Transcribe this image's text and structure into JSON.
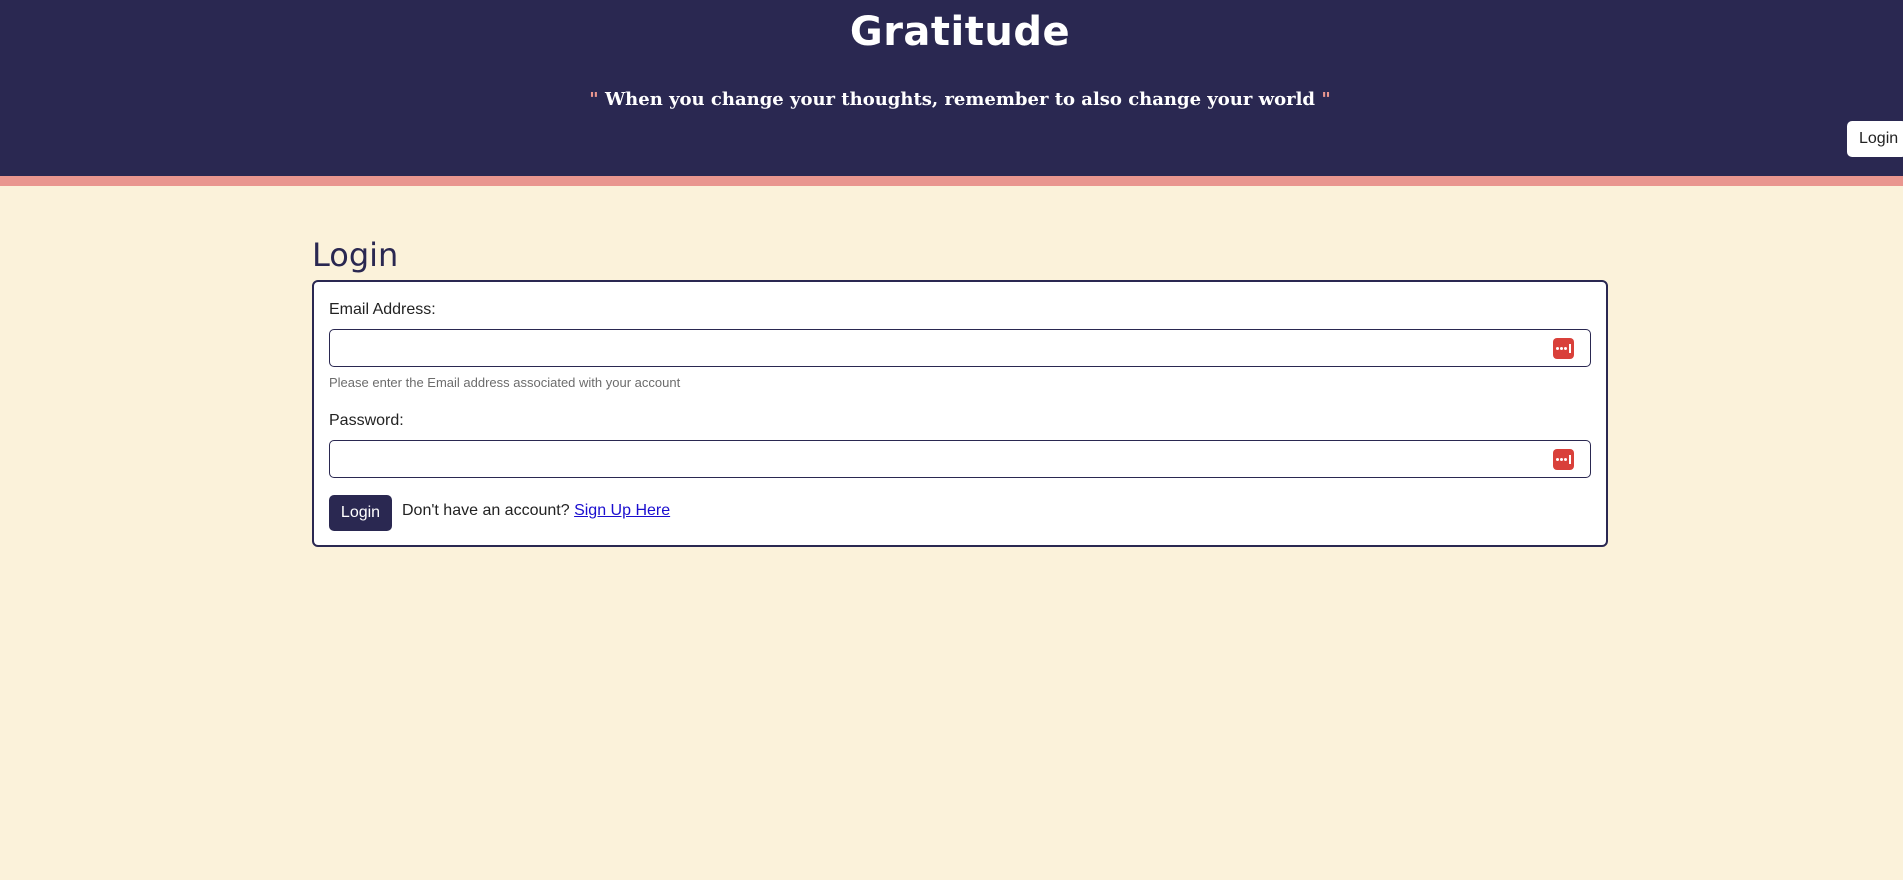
{
  "header": {
    "title": "Gratitude",
    "quote": {
      "open_mark": "\"",
      "text": "When you change your thoughts, remember to also change your world",
      "close_mark": "\""
    },
    "login_button": "Login"
  },
  "page": {
    "title": "Login"
  },
  "form": {
    "email_label": "Email Address:",
    "email_value": "",
    "email_help": "Please enter the Email address associated with your account",
    "password_label": "Password:",
    "password_value": "",
    "submit_label": "Login",
    "signup_prompt": "Don't have an account?",
    "signup_link": "Sign Up Here"
  },
  "colors": {
    "header_bg": "#2a2851",
    "accent_stripe": "#e9968f",
    "page_bg": "#fbf2da",
    "password_manager_icon": "#d9403a",
    "link": "#1a0dcf"
  },
  "icons": {
    "password_manager": "password-manager-icon"
  }
}
